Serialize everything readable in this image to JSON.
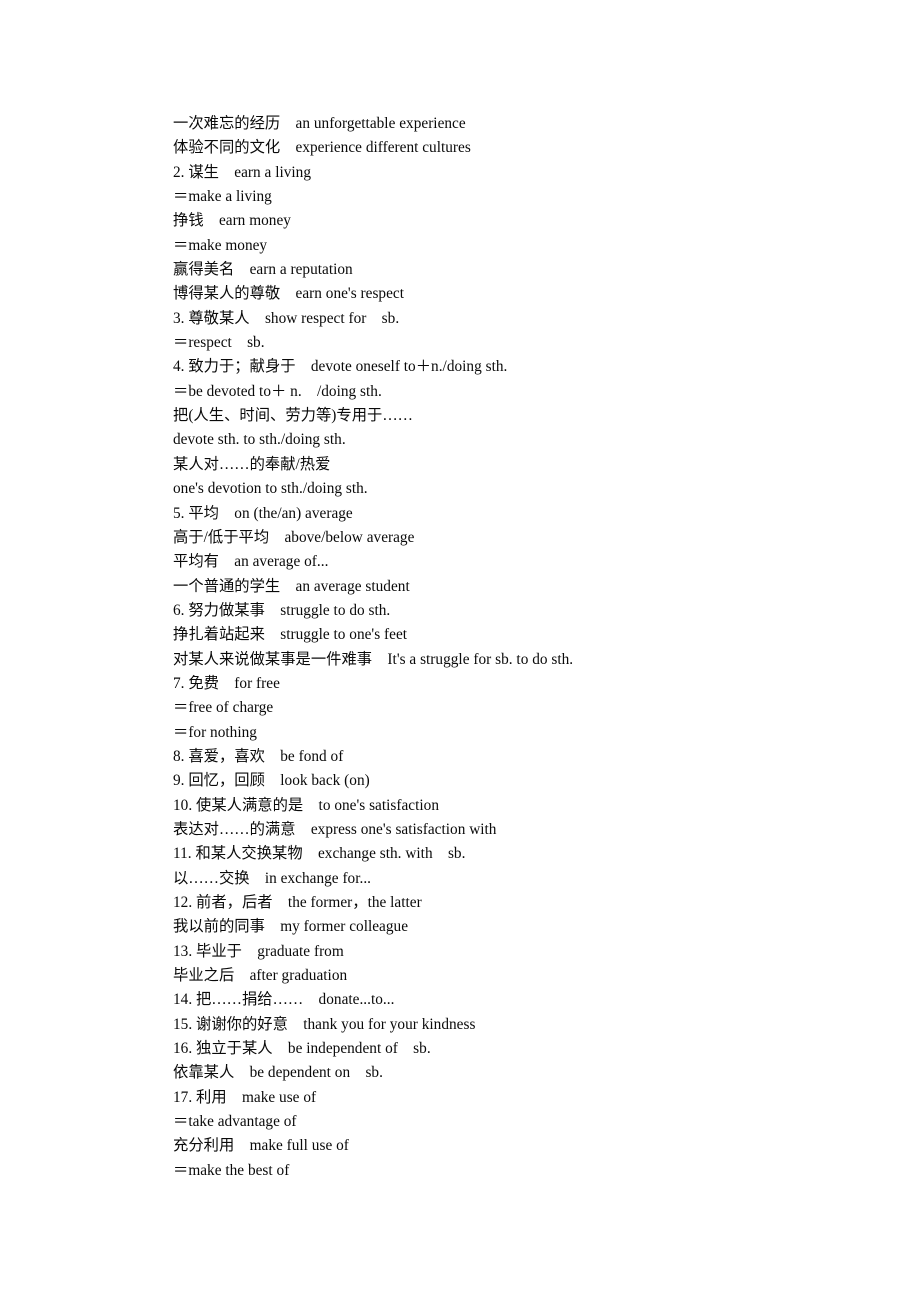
{
  "page": {
    "background_color": "#ffffff",
    "text_color": "#0a0a0a",
    "document_type": "vocabulary-notes",
    "language_mix": "Chinese-English"
  },
  "lines": [
    {
      "text": "一次难忘的经历　an unforgettable experience"
    },
    {
      "text": "体验不同的文化　experience different cultures"
    },
    {
      "text": "2. 谋生　earn a living"
    },
    {
      "text": "＝make a living"
    },
    {
      "text": "挣钱　earn money"
    },
    {
      "text": "＝make money"
    },
    {
      "text": "赢得美名　earn a reputation"
    },
    {
      "text": "博得某人的尊敬　earn one's respect"
    },
    {
      "text": "3. 尊敬某人　show respect for　sb."
    },
    {
      "text": "＝respect　sb."
    },
    {
      "text": "4. 致力于；献身于　devote oneself to＋n./doing sth."
    },
    {
      "text": "＝be devoted to＋ n.　/doing sth."
    },
    {
      "text": "把(人生、时间、劳力等)专用于……"
    },
    {
      "text": "devote sth. to sth./doing sth."
    },
    {
      "text": "某人对……的奉献/热爱"
    },
    {
      "text": "one's devotion to sth./doing sth."
    },
    {
      "text": "5. 平均　on (the/an) average"
    },
    {
      "text": "高于/低于平均　above/below average"
    },
    {
      "text": "平均有　an average of..."
    },
    {
      "text": "一个普通的学生　an average student"
    },
    {
      "text": "6. 努力做某事　struggle to do sth."
    },
    {
      "text": "挣扎着站起来　struggle to one's feet"
    },
    {
      "text": "对某人来说做某事是一件难事　It's a struggle for sb. to do sth."
    },
    {
      "text": "7. 免费　for free"
    },
    {
      "text": "＝free of charge"
    },
    {
      "text": "＝for nothing"
    },
    {
      "text": "8. 喜爱，喜欢　be fond of"
    },
    {
      "text": "9. 回忆，回顾　look back (on)"
    },
    {
      "text": "10. 使某人满意的是　to one's satisfaction"
    },
    {
      "text": "表达对……的满意　express one's satisfaction with"
    },
    {
      "text": "11. 和某人交换某物　exchange sth. with　sb."
    },
    {
      "text": "以……交换　in exchange for..."
    },
    {
      "text": "12. 前者，后者　the former，the latter"
    },
    {
      "text": "我以前的同事　my former colleague"
    },
    {
      "text": "13. 毕业于　graduate from"
    },
    {
      "text": "毕业之后　after graduation"
    },
    {
      "text": "14. 把……捐给……　donate...to..."
    },
    {
      "text": "15. 谢谢你的好意　thank you for your kindness"
    },
    {
      "text": "16. 独立于某人　be independent of　sb."
    },
    {
      "text": "依靠某人　be dependent on　sb."
    },
    {
      "text": "17. 利用　make use of"
    },
    {
      "text": "＝take advantage of"
    },
    {
      "text": "充分利用　make full use of"
    },
    {
      "text": "＝make the best of"
    }
  ]
}
